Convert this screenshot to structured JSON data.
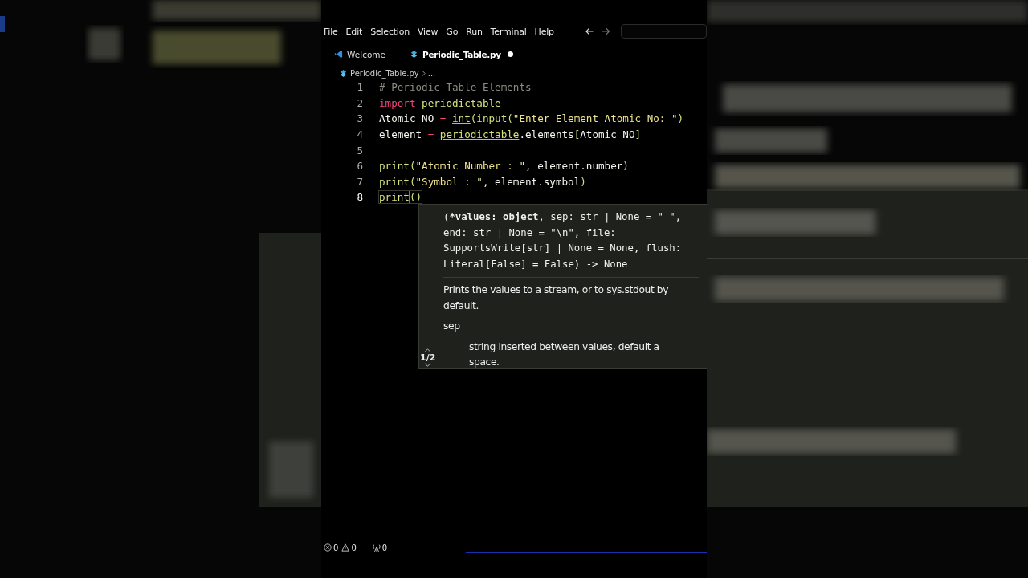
{
  "menu": [
    "File",
    "Edit",
    "Selection",
    "View",
    "Go",
    "Run",
    "Terminal",
    "Help"
  ],
  "tabs": [
    {
      "label": "Welcome",
      "kind": "welcome",
      "selected": false,
      "modified": false
    },
    {
      "label": "Periodic_Table.py",
      "kind": "python",
      "selected": true,
      "modified": true
    }
  ],
  "breadcrumb": {
    "file": "Periodic_Table.py",
    "rest": "..."
  },
  "lines": [
    {
      "number": "1",
      "current": false,
      "tokens": [
        {
          "kind": "comment",
          "text": "# Periodic Table Elements"
        }
      ]
    },
    {
      "number": "2",
      "current": false,
      "tokens": [
        {
          "kind": "keyword",
          "text": "import "
        },
        {
          "kind": "module",
          "text": "periodictable"
        }
      ]
    },
    {
      "number": "3",
      "current": false,
      "tokens": [
        {
          "kind": "plain",
          "text": "Atomic_NO"
        },
        {
          "kind": "op",
          "text": " = "
        },
        {
          "kind": "module",
          "text": "int"
        },
        {
          "kind": "func",
          "text": "(input("
        },
        {
          "kind": "str",
          "text": "\"Enter Element Atomic No: \""
        },
        {
          "kind": "func",
          "text": ")"
        }
      ]
    },
    {
      "number": "4",
      "current": false,
      "tokens": [
        {
          "kind": "plain",
          "text": "element"
        },
        {
          "kind": "op",
          "text": " = "
        },
        {
          "kind": "module",
          "text": "periodictable"
        },
        {
          "kind": "plain",
          "text": ".elements"
        },
        {
          "kind": "func",
          "text": "["
        },
        {
          "kind": "plain",
          "text": "Atomic_NO"
        },
        {
          "kind": "func",
          "text": "]"
        }
      ]
    },
    {
      "number": "5",
      "current": false
    },
    {
      "number": "6",
      "current": false,
      "tokens": [
        {
          "kind": "func",
          "text": "print("
        },
        {
          "kind": "str",
          "text": "\"Atomic Number : \""
        },
        {
          "kind": "plain",
          "text": ", element.number"
        },
        {
          "kind": "func",
          "text": ")"
        }
      ]
    },
    {
      "number": "7",
      "current": false,
      "tokens": [
        {
          "kind": "func",
          "text": "print("
        },
        {
          "kind": "str",
          "text": "\"Symbol : \""
        },
        {
          "kind": "plain",
          "text": ", element.symbol"
        },
        {
          "kind": "func",
          "text": ")"
        }
      ]
    },
    {
      "number": "8",
      "current": true,
      "tokens": [
        {
          "kind": "func",
          "text": "print"
        },
        {
          "kind": "bracket",
          "text": "()"
        }
      ]
    }
  ],
  "hover": {
    "signature": [
      {
        "text": "(",
        "bold": false
      },
      {
        "text": "*values: object",
        "bold": true
      },
      {
        "text": ", sep: str | None = \" \", end: str | None = \"\\n\", file: SupportsWrite[str] | None = None, flush: Literal[False] = False) -> None",
        "bold": false
      }
    ],
    "description": "Prints the values to a stream, or to sys.stdout by default.",
    "param": "sep",
    "param_doc": "string inserted between values, default a space.",
    "counter": "1/2"
  },
  "status": {
    "errors": "0",
    "warnings": "0",
    "ports": "0"
  }
}
